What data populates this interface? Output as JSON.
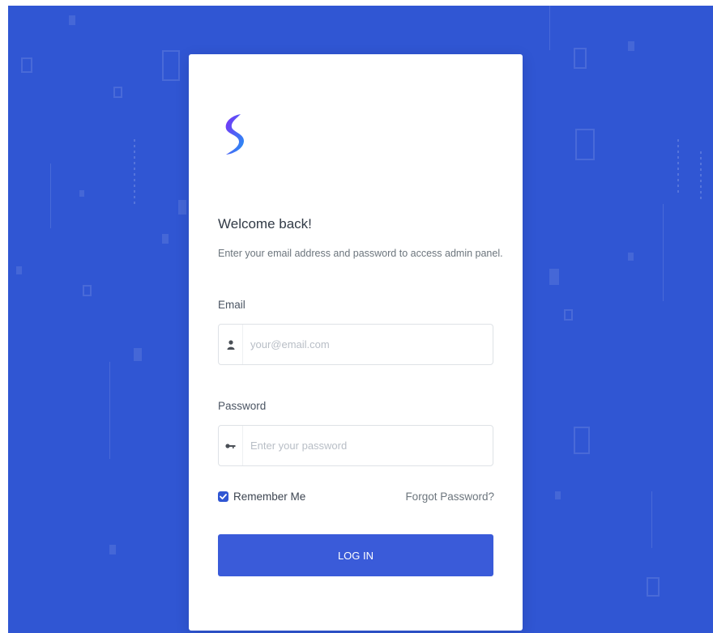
{
  "colors": {
    "background": "#3056d3",
    "primary": "#3a5bd9",
    "logo_gradient_start": "#7b2ff7",
    "logo_gradient_end": "#2196f3"
  },
  "logo": {
    "icon": "brand-s-logo-icon"
  },
  "login": {
    "title": "Welcome back!",
    "subtitle": "Enter your email address and password to access admin panel.",
    "email": {
      "label": "Email",
      "placeholder": "your@email.com",
      "value": "",
      "icon": "user-icon"
    },
    "password": {
      "label": "Password",
      "placeholder": "Enter your password",
      "value": "",
      "icon": "key-icon"
    },
    "remember_me": {
      "label": "Remember Me",
      "checked": true
    },
    "forgot_password": "Forgot Password?",
    "submit_label": "LOG IN"
  }
}
